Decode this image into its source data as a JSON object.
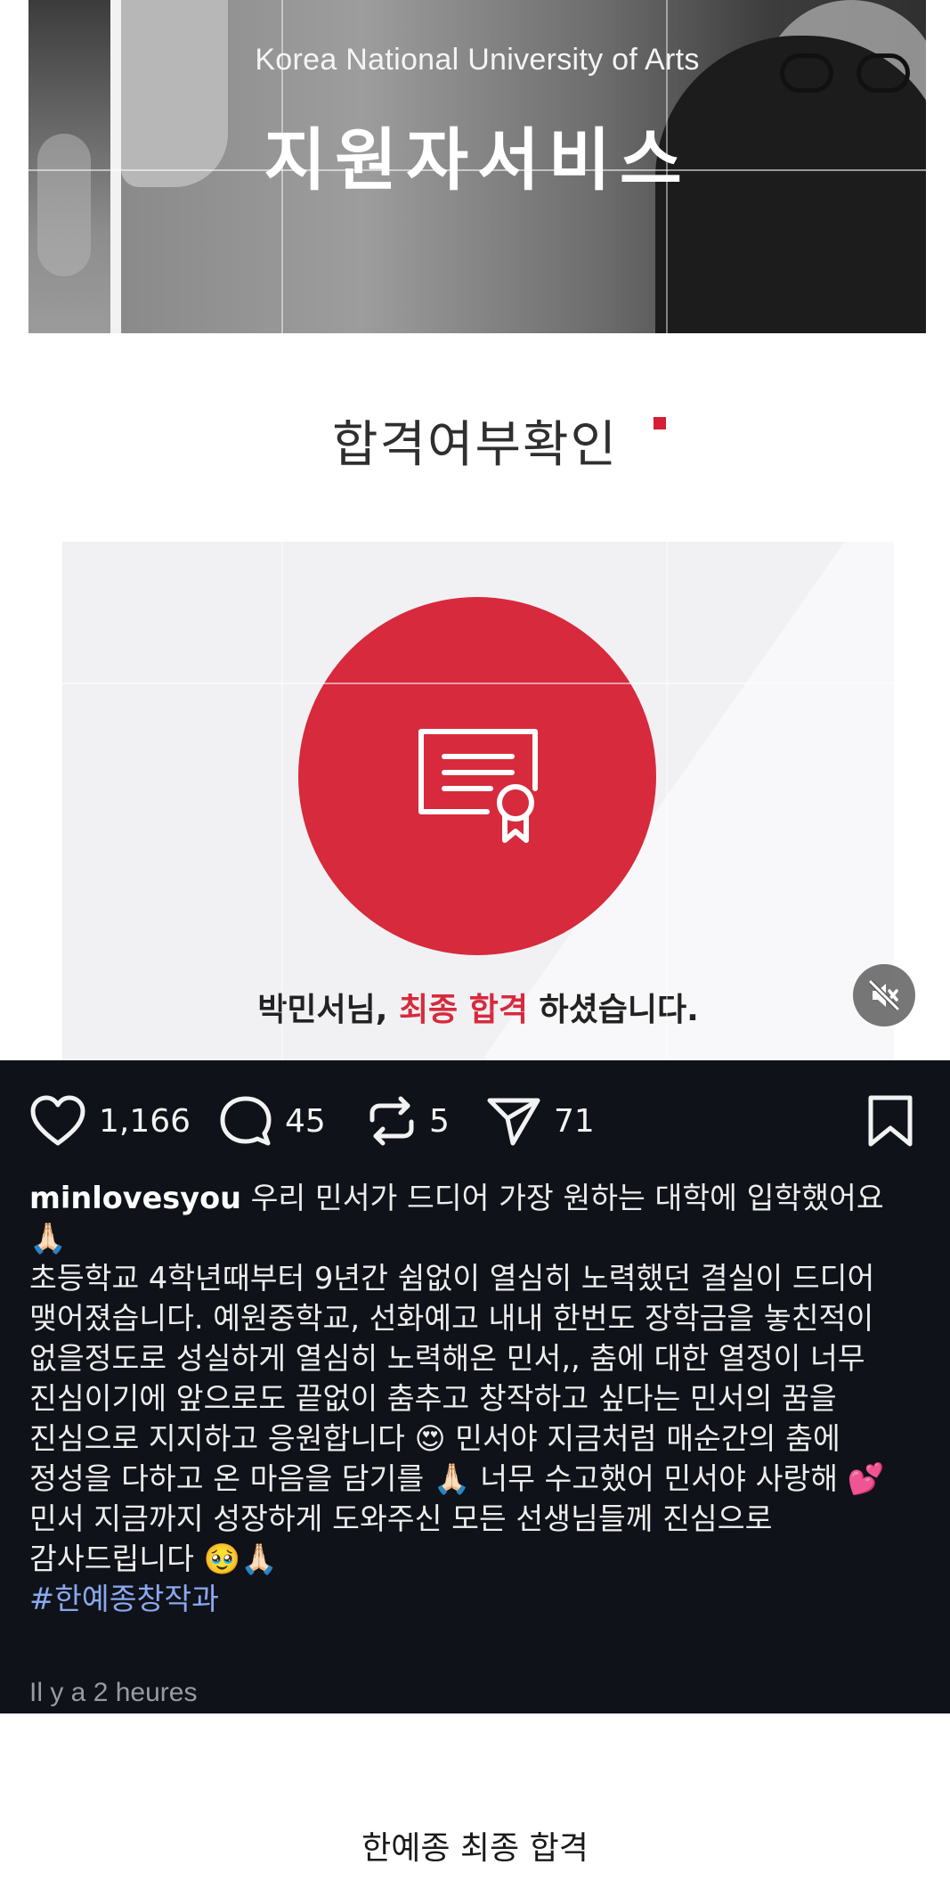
{
  "banner": {
    "subtitle": "Korea National University of Arts",
    "title": "지원자서비스"
  },
  "result_page": {
    "title": "합격여부확인",
    "message_name": "박민서님, ",
    "message_highlight": "최종 합격",
    "message_tail": " 하셨습니다.",
    "accent_color": "#d72a3d"
  },
  "media": {
    "mute_icon": "speaker-muted-icon"
  },
  "actions": {
    "likes": "1,166",
    "comments": "45",
    "reposts": "5",
    "shares": "71"
  },
  "post": {
    "username": "minlovesyou",
    "line1": " 우리 민서가 드디어 가장 원하는 대학에 입학했어요 🙏🏻",
    "line2": "초등학교 4학년때부터 9년간 쉼없이 열심히 노력했던 결실이 드디어 맺어졌습니다. 예원중학교, 선화예고 내내 한번도 장학금을 놓친적이 없을정도로 성실하게 열심히 노력해온 민서,, 춤에 대한 열정이 너무 진심이기에 앞으로도 끝없이 춤추고 창작하고 싶다는 민서의 꿈을 진심으로 지지하고 응원합니다 😍 민서야 지금처럼 매순간의 춤에 정성을 다하고 온 마음을 담기를 🙏🏻 너무 수고했어 민서야 사랑해 💕",
    "line3": "민서 지금까지 성장하게 도와주신 모든 선생님들께 진심으로 감사드립니다 🥹🙏🏻",
    "hashtag": "#한예종창작과",
    "timestamp": "Il y a 2 heures"
  },
  "footer": {
    "caption": "한예종 최종 합격"
  }
}
